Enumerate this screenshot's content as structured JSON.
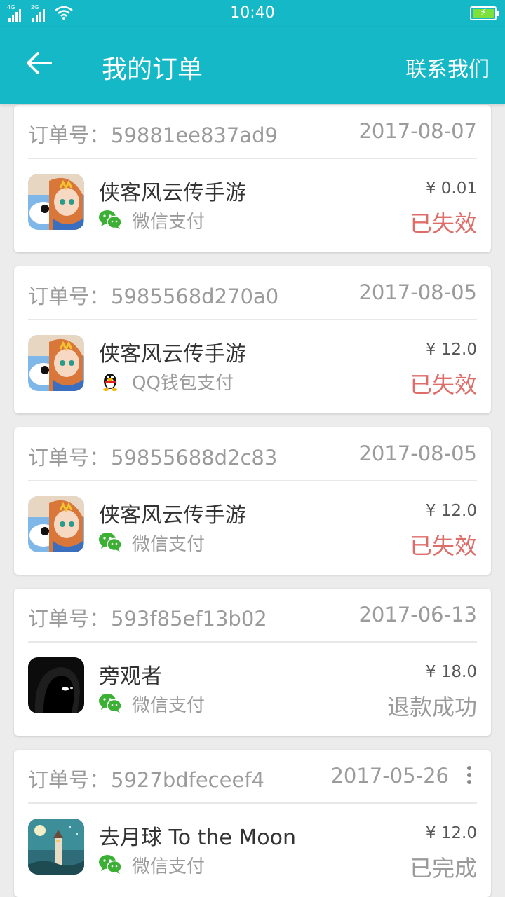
{
  "status_bar": {
    "time": "10:40",
    "network_1": "4G",
    "network_2": "2G",
    "battery_icon": "battery-charging-icon"
  },
  "header": {
    "back_icon": "arrow-left-icon",
    "title": "我的订单",
    "contact": "联系我们"
  },
  "order_label": "订单号：",
  "orders": [
    {
      "order_no": "59881ee837ad9",
      "date": "2017-08-07",
      "game": "侠客风云传手游",
      "pay_method": "微信支付",
      "pay_icon": "wechat-icon",
      "price": "¥ 0.01",
      "status": "已失效",
      "app_icon": "xiake-game-icon"
    },
    {
      "order_no": "5985568d270a0",
      "date": "2017-08-05",
      "game": "侠客风云传手游",
      "pay_method": "QQ钱包支付",
      "pay_icon": "qq-penguin-icon",
      "price": "¥ 12.0",
      "status": "已失效",
      "app_icon": "xiake-game-icon"
    },
    {
      "order_no": "59855688d2c83",
      "date": "2017-08-05",
      "game": "侠客风云传手游",
      "pay_method": "微信支付",
      "pay_icon": "wechat-icon",
      "price": "¥ 12.0",
      "status": "已失效",
      "app_icon": "xiake-game-icon"
    },
    {
      "order_no": "593f85ef13b02",
      "date": "2017-06-13",
      "game": "旁观者",
      "pay_method": "微信支付",
      "pay_icon": "wechat-icon",
      "price": "¥ 18.0",
      "status": "退款成功",
      "app_icon": "beholder-game-icon"
    },
    {
      "order_no": "5927bdfeceef4",
      "date": "2017-05-26",
      "game": "去月球 To the Moon",
      "pay_method": "微信支付",
      "pay_icon": "wechat-icon",
      "price": "¥ 12.0",
      "status": "已完成",
      "app_icon": "to-the-moon-game-icon",
      "more_icon": "more-vertical-icon"
    }
  ],
  "colors": {
    "primary": "#15b8c6",
    "invalid": "#d9534f",
    "muted": "#9b9b9b",
    "wechat": "#3cb034"
  }
}
